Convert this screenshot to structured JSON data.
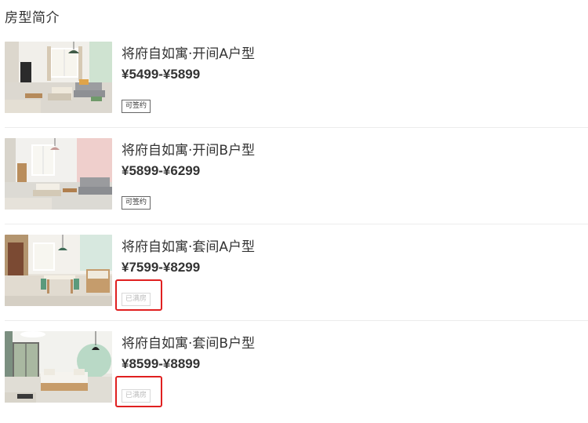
{
  "section": {
    "title": "房型简介"
  },
  "rooms": [
    {
      "name": "将府自如寓·开间A户型",
      "price": "¥5499-¥5899",
      "status": "可签约",
      "full": false,
      "photo": "studio-a-photo"
    },
    {
      "name": "将府自如寓·开间B户型",
      "price": "¥5899-¥6299",
      "status": "可签约",
      "full": false,
      "photo": "studio-b-photo"
    },
    {
      "name": "将府自如寓·套间A户型",
      "price": "¥7599-¥8299",
      "status": "已满房",
      "full": true,
      "photo": "suite-a-photo"
    },
    {
      "name": "将府自如寓·套间B户型",
      "price": "¥8599-¥8899",
      "status": "已满房",
      "full": true,
      "photo": "suite-b-photo"
    }
  ],
  "colors": {
    "text": "#333333",
    "divider": "#ececec",
    "status_available_border": "#666666",
    "status_full_text": "#bdbdbd",
    "highlight": "#e02020"
  }
}
